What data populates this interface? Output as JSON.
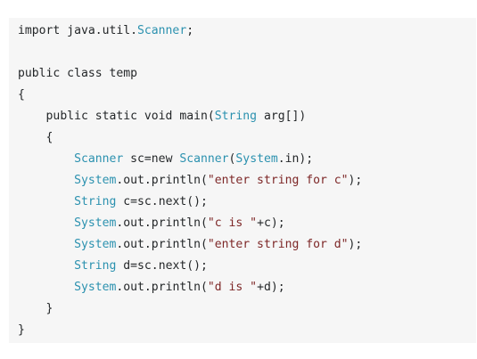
{
  "code": {
    "lines": [
      {
        "indent": "",
        "tokens": [
          {
            "t": "import java.util.",
            "c": "plain"
          },
          {
            "t": "Scanner",
            "c": "type"
          },
          {
            "t": ";",
            "c": "plain"
          }
        ]
      },
      {
        "indent": "",
        "tokens": []
      },
      {
        "indent": "",
        "tokens": [
          {
            "t": "public class temp",
            "c": "plain"
          }
        ]
      },
      {
        "indent": "",
        "tokens": [
          {
            "t": "{",
            "c": "plain"
          }
        ]
      },
      {
        "indent": "    ",
        "tokens": [
          {
            "t": "public static void main(",
            "c": "plain"
          },
          {
            "t": "String",
            "c": "type"
          },
          {
            "t": " arg[])",
            "c": "plain"
          }
        ]
      },
      {
        "indent": "    ",
        "tokens": [
          {
            "t": "{",
            "c": "plain"
          }
        ]
      },
      {
        "indent": "        ",
        "tokens": [
          {
            "t": "Scanner",
            "c": "type"
          },
          {
            "t": " sc=new ",
            "c": "plain"
          },
          {
            "t": "Scanner",
            "c": "type"
          },
          {
            "t": "(",
            "c": "plain"
          },
          {
            "t": "System",
            "c": "type"
          },
          {
            "t": ".in);",
            "c": "plain"
          }
        ]
      },
      {
        "indent": "        ",
        "tokens": [
          {
            "t": "System",
            "c": "type"
          },
          {
            "t": ".out.println(",
            "c": "plain"
          },
          {
            "t": "\"enter string for c\"",
            "c": "str"
          },
          {
            "t": ");",
            "c": "plain"
          }
        ]
      },
      {
        "indent": "        ",
        "tokens": [
          {
            "t": "String",
            "c": "type"
          },
          {
            "t": " c=sc.next();",
            "c": "plain"
          }
        ]
      },
      {
        "indent": "        ",
        "tokens": [
          {
            "t": "System",
            "c": "type"
          },
          {
            "t": ".out.println(",
            "c": "plain"
          },
          {
            "t": "\"c is \"",
            "c": "str"
          },
          {
            "t": "+c);",
            "c": "plain"
          }
        ]
      },
      {
        "indent": "        ",
        "tokens": [
          {
            "t": "System",
            "c": "type"
          },
          {
            "t": ".out.println(",
            "c": "plain"
          },
          {
            "t": "\"enter string for d\"",
            "c": "str"
          },
          {
            "t": ");",
            "c": "plain"
          }
        ]
      },
      {
        "indent": "        ",
        "tokens": [
          {
            "t": "String",
            "c": "type"
          },
          {
            "t": " d=sc.next();",
            "c": "plain"
          }
        ]
      },
      {
        "indent": "        ",
        "tokens": [
          {
            "t": "System",
            "c": "type"
          },
          {
            "t": ".out.println(",
            "c": "plain"
          },
          {
            "t": "\"d is \"",
            "c": "str"
          },
          {
            "t": "+d);",
            "c": "plain"
          }
        ]
      },
      {
        "indent": "    ",
        "tokens": [
          {
            "t": "}",
            "c": "plain"
          }
        ]
      },
      {
        "indent": "",
        "tokens": [
          {
            "t": "}",
            "c": "plain"
          }
        ]
      }
    ]
  },
  "colors": {
    "background": "#f6f6f6",
    "plain": "#242729",
    "type": "#2b91af",
    "string": "#7d2727"
  }
}
